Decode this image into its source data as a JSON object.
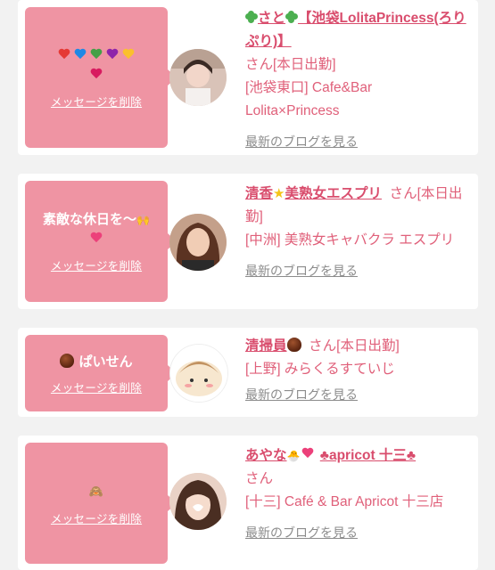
{
  "cards": [
    {
      "message_emoji_colors": [
        "#e53935",
        "#1e88e5",
        "#43a047",
        "#8e24aa",
        "#fbc02d",
        "#d81b60"
      ],
      "delete_label": "メッセージを削除",
      "name_prefix": "さと",
      "name_main": "【池袋LolitaPrincess(ろりぷり)】",
      "suffix": "さん[本日出勤]",
      "shop": "[池袋東口] Cafe&Bar Lolita×Princess",
      "blog_label": "最新のブログを見る"
    },
    {
      "message": "素敵な休日を〜",
      "delete_label": "メッセージを削除",
      "name_a": "清香",
      "name_b": "美熟女エスプリ",
      "suffix": "さん[本日出勤]",
      "shop": "[中洲] 美熟女キャバクラ エスプリ",
      "blog_label": "最新のブログを見る"
    },
    {
      "message": "ぱいせん",
      "delete_label": "メッセージを削除",
      "name": "清掃員",
      "suffix": "さん[本日出勤]",
      "shop": "[上野] みらくるすていじ",
      "blog_label": "最新のブログを見る"
    },
    {
      "message_glyph": "🙈",
      "delete_label": "メッセージを削除",
      "name_a": "あやな",
      "name_b": "♣apricot 十三♣",
      "suffix": "さん",
      "shop": "[十三] Café & Bar Apricot 十三店",
      "blog_label": "最新のブログを見る"
    }
  ]
}
